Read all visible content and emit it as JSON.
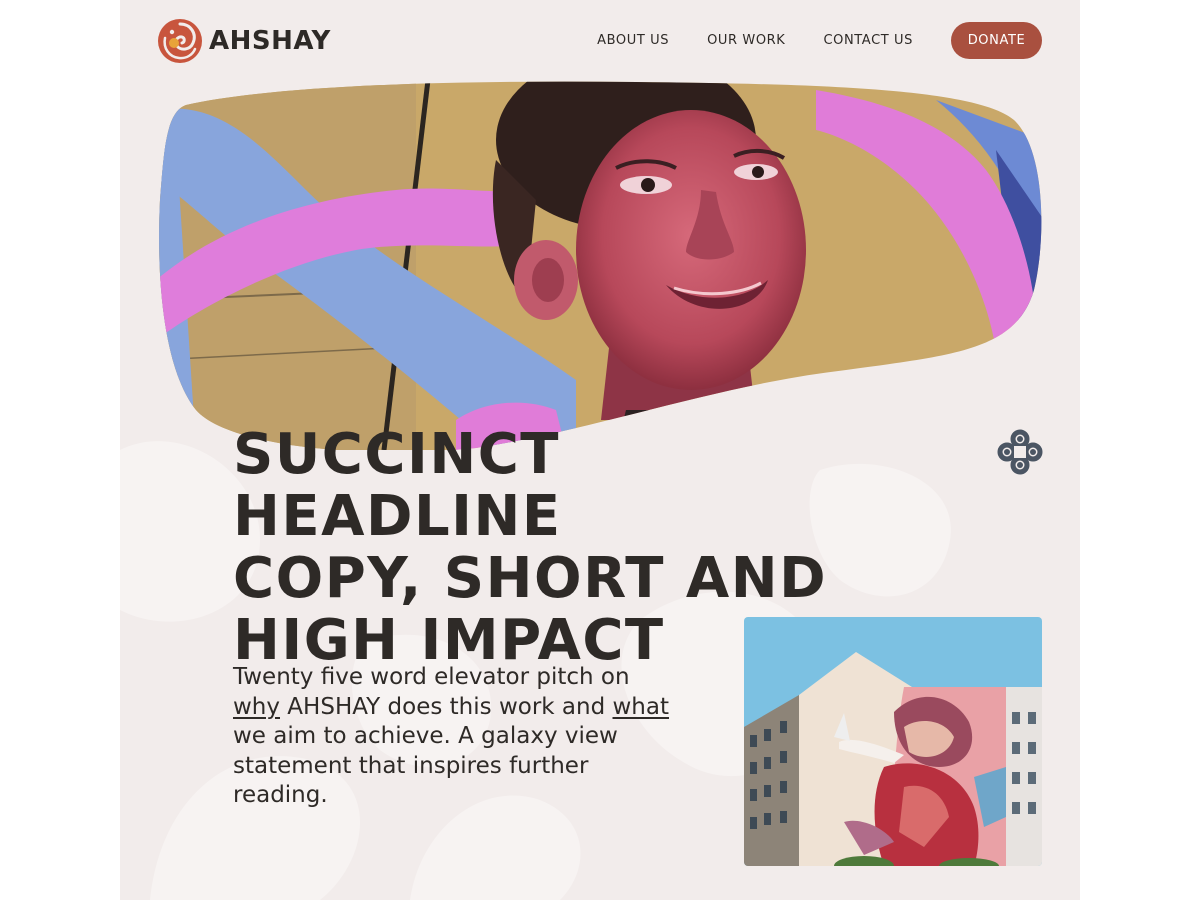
{
  "brand": {
    "name": "AHSHAY",
    "accent_color": "#a9503f",
    "logo_colors": [
      "#c8553d",
      "#e8a33a"
    ]
  },
  "nav": {
    "links": [
      "ABOUT US",
      "OUR WORK",
      "CONTACT US"
    ],
    "donate_label": "DONATE"
  },
  "hero": {
    "image": "street-mural-girl-portrait",
    "headline_line1": "SUCCINCT HEADLINE",
    "headline_line2": "COPY, SHORT AND",
    "headline_line3": "HIGH IMPACT"
  },
  "ornament_icon": "four-petal-knot-icon",
  "pitch": {
    "part1": "Twenty five word elevator pitch on ",
    "link1": "why",
    "part2": " AHSHAY does this work and ",
    "link2": "what",
    "part3": " we aim to achieve. A galaxy view statement that inspires further reading."
  },
  "side_photo": {
    "image": "building-mural-photo"
  },
  "colors": {
    "page_background": "#f2eceb",
    "text": "#2e2a27"
  }
}
